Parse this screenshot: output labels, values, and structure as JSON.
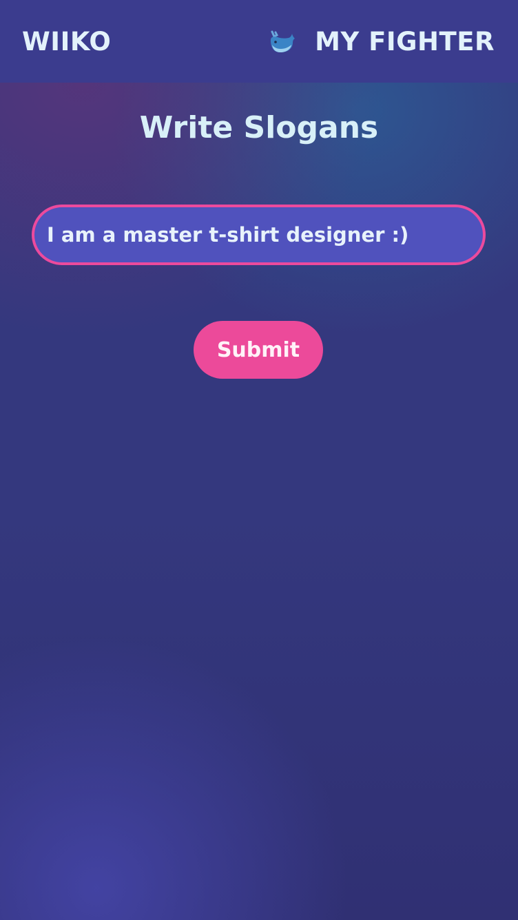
{
  "header": {
    "brand": "WIIKO",
    "nav_label": "MY FIGHTER",
    "nav_icon": "whale-icon",
    "background_color": "#3b3c8e",
    "text_color": "#e3f2fb"
  },
  "main": {
    "title": "Write Slogans",
    "slogan_input": {
      "value": "I am a master t-shirt designer :)",
      "placeholder": ""
    },
    "submit_label": "Submit"
  },
  "colors": {
    "accent": "#ec4a9a",
    "input_fill": "#5052bd",
    "background": "#34387e"
  }
}
